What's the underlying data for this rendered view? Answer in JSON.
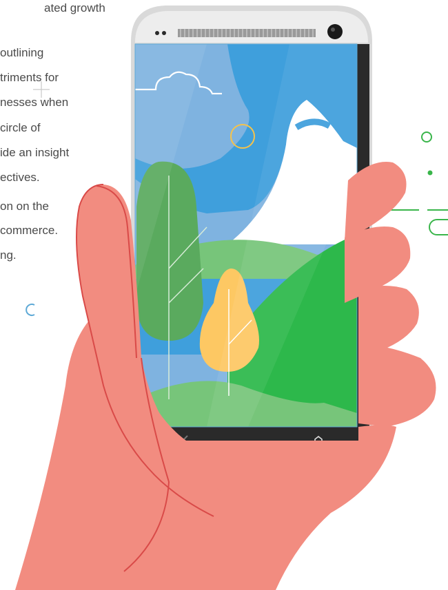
{
  "text": {
    "lines": [
      "ated growth",
      "outlining",
      "triments for",
      "nesses when",
      "circle of",
      "ide an insight",
      "ectives.",
      "on on the",
      "commerce.",
      "ng."
    ]
  },
  "colors": {
    "hand": "#f28c80",
    "hand_outline": "#d94a48",
    "sky": "#7fb3e0",
    "sky_dark": "#3f9fdc",
    "hill_light": "#77c57a",
    "hill_dark": "#2db84b",
    "tree_green": "#5aaa5e",
    "tree_yellow": "#fdc863",
    "phone_silver": "#d9d9d9",
    "phone_dark": "#2a2a2a",
    "accent_green": "#39b54a",
    "accent_yellow": "#f6c34a",
    "accent_blue": "#5da9d6"
  },
  "icons": [
    "back-icon",
    "home-icon",
    "camera-icon",
    "speaker-grille",
    "cloud-icon"
  ]
}
